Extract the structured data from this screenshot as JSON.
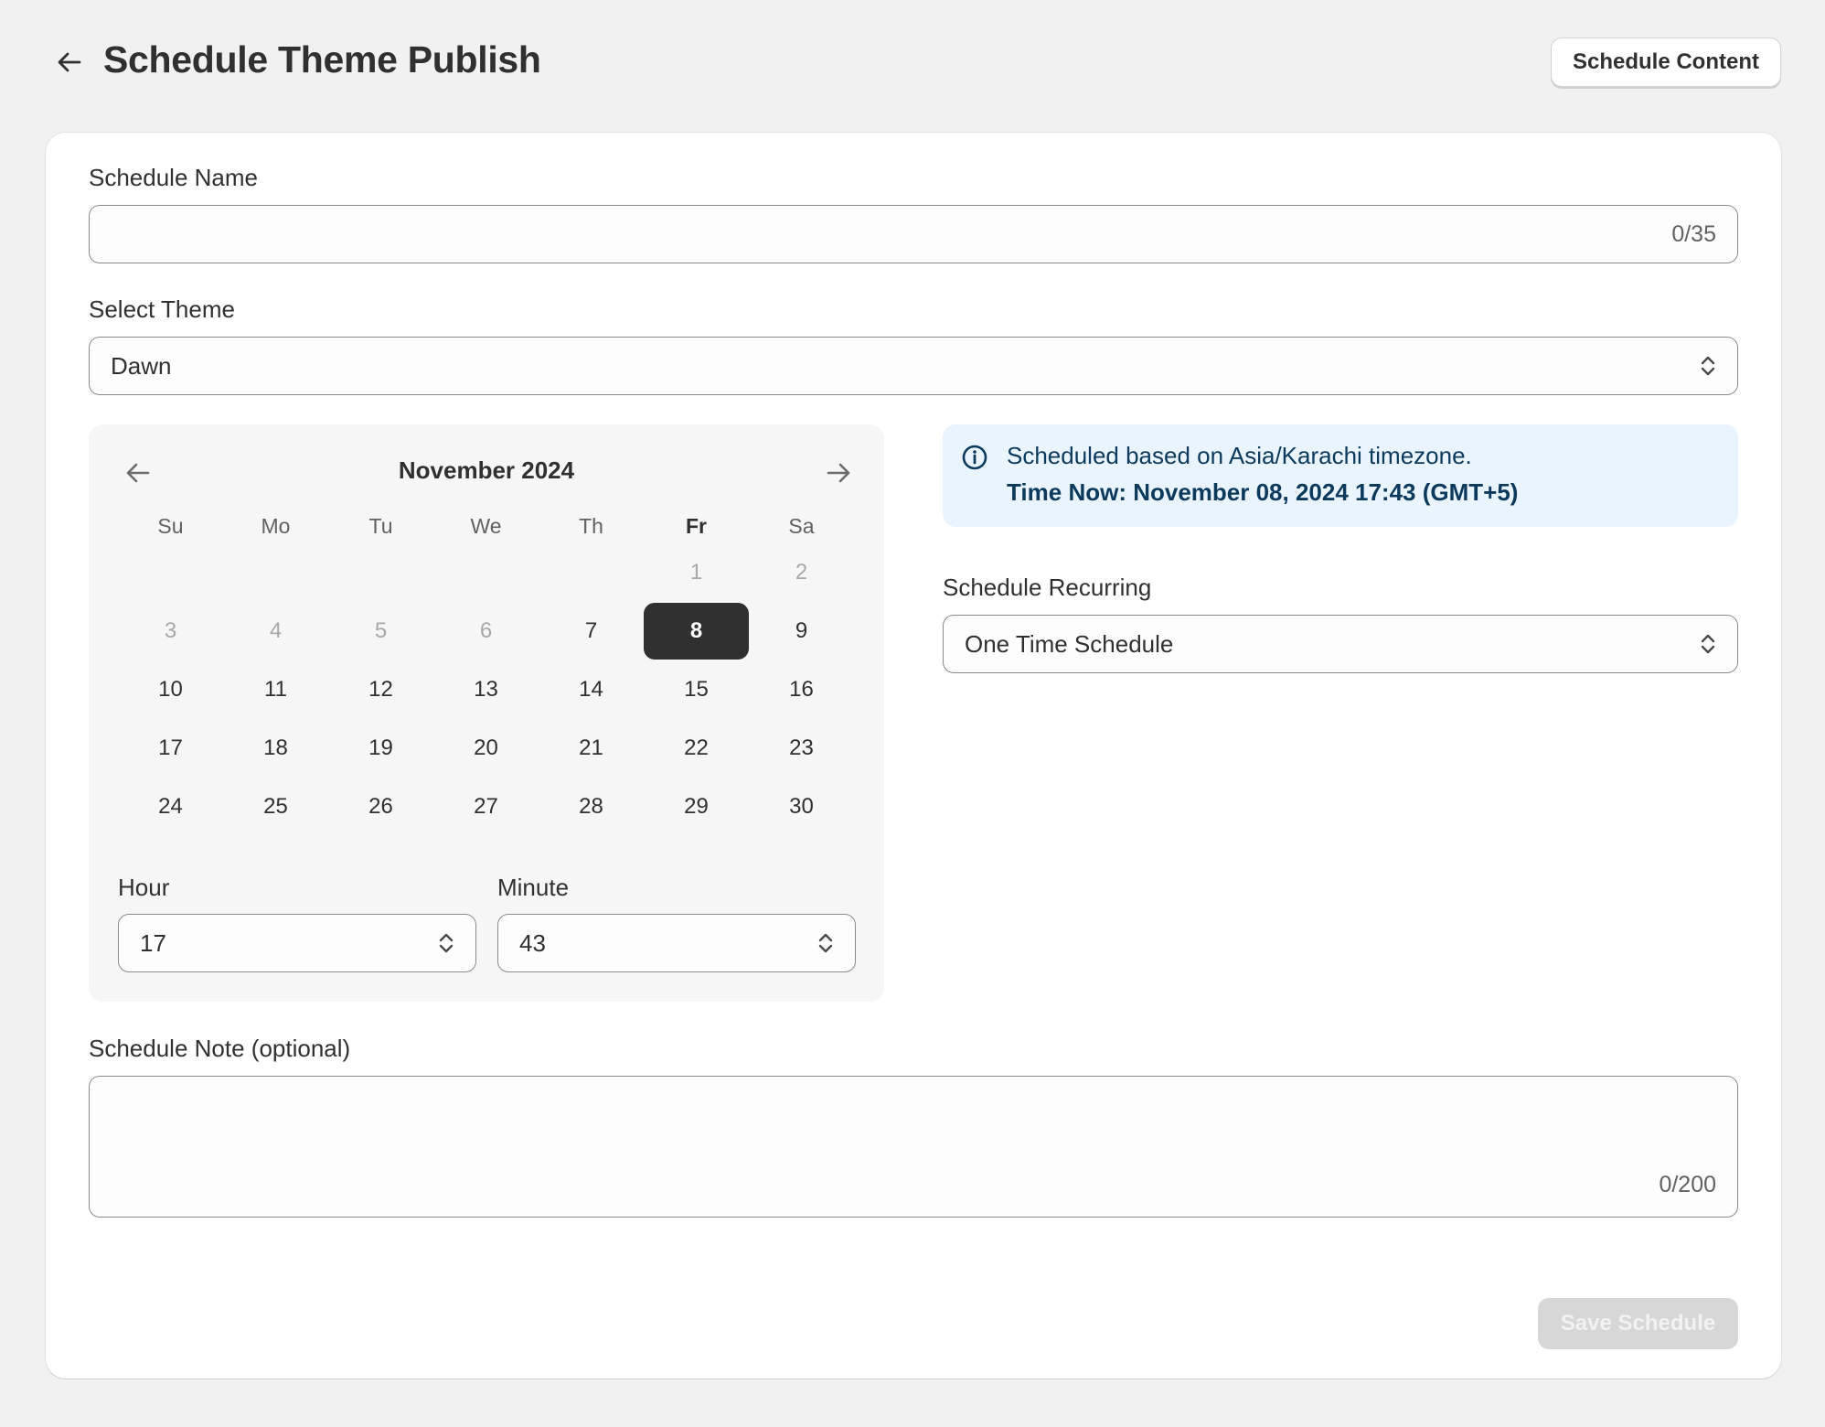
{
  "header": {
    "title": "Schedule Theme Publish",
    "schedule_content_label": "Schedule Content"
  },
  "form": {
    "schedule_name": {
      "label": "Schedule Name",
      "value": "",
      "counter": "0/35"
    },
    "theme": {
      "label": "Select Theme",
      "value": "Dawn"
    },
    "calendar": {
      "month_label": "November 2024",
      "weekdays": [
        "Su",
        "Mo",
        "Tu",
        "We",
        "Th",
        "Fr",
        "Sa"
      ],
      "highlight_weekday": "Fr",
      "weeks": [
        [
          "",
          "",
          "",
          "",
          "",
          "1",
          "2"
        ],
        [
          "3",
          "4",
          "5",
          "6",
          "7",
          "8",
          "9"
        ],
        [
          "10",
          "11",
          "12",
          "13",
          "14",
          "15",
          "16"
        ],
        [
          "17",
          "18",
          "19",
          "20",
          "21",
          "22",
          "23"
        ],
        [
          "24",
          "25",
          "26",
          "27",
          "28",
          "29",
          "30"
        ]
      ],
      "selected_day": "8",
      "past_days": [
        "1",
        "2",
        "3",
        "4",
        "5",
        "6"
      ]
    },
    "hour": {
      "label": "Hour",
      "value": "17"
    },
    "minute": {
      "label": "Minute",
      "value": "43"
    },
    "banner": {
      "line1": "Scheduled based on Asia/Karachi timezone.",
      "line2": "Time Now: November 08, 2024 17:43 (GMT+5)"
    },
    "recurring": {
      "label": "Schedule Recurring",
      "value": "One Time Schedule"
    },
    "note": {
      "label": "Schedule Note (optional)",
      "value": "",
      "counter": "0/200"
    },
    "save_label": "Save Schedule"
  },
  "colors": {
    "page_bg": "#f1f1f1",
    "card_bg": "#ffffff",
    "selected_day_bg": "#303030",
    "banner_bg": "#eaf4ff",
    "banner_text": "#0b3a5c",
    "disabled_button_bg": "#d7d7d7"
  },
  "icons": [
    "arrow-left-icon",
    "arrow-right-icon",
    "select-arrows-icon",
    "info-icon"
  ]
}
